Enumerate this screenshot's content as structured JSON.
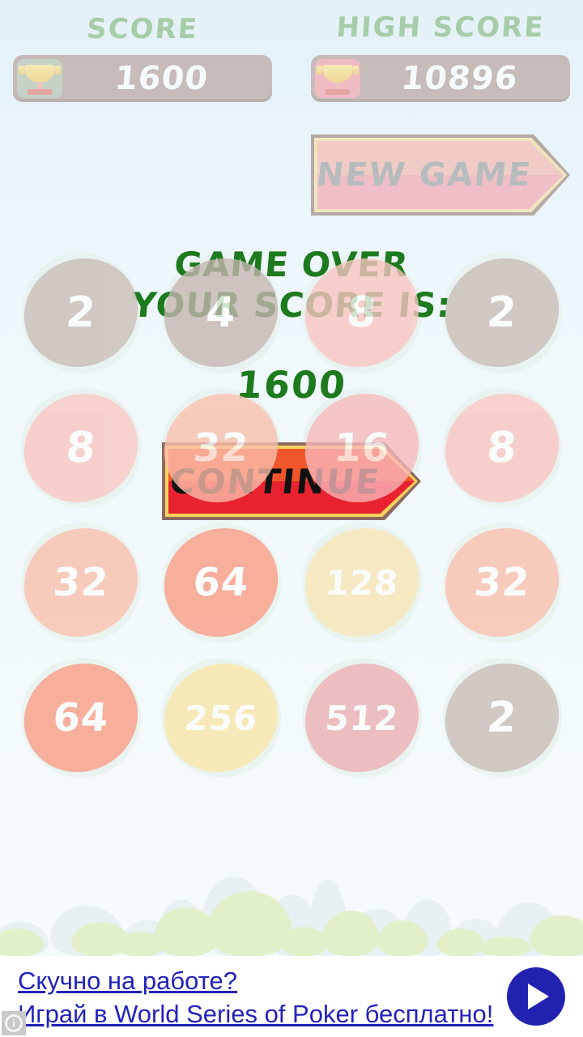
{
  "header": {
    "score_label": "Score",
    "score_value": "1600",
    "high_score_label": "High Score",
    "high_score_value": "10896",
    "score_trophy_icon": "trophy-icon",
    "high_score_trophy_icon": "trophy-icon",
    "label_color": "#8fbf8a",
    "panel_color": "#b49b92"
  },
  "new_game_button": {
    "label": "New Game",
    "label_color": "#8d8d8d",
    "fill_top": "#f6a99b",
    "fill_bottom": "#f2919c"
  },
  "game_over": {
    "line1": "Game Over",
    "line2": "Your Score is:",
    "score": "1600",
    "text_color": "#1d7a1d",
    "continue_label": "Continue",
    "continue_label_color": "#111111",
    "continue_fill_top": "#f1562a",
    "continue_fill_bottom": "#e8232f"
  },
  "grid": {
    "rows": 4,
    "cols": 4,
    "cell_bg": "#e5f1ee",
    "tiles": [
      [
        "2",
        "4",
        "8",
        "2"
      ],
      [
        "8",
        "32",
        "16",
        "8"
      ],
      [
        "32",
        "64",
        "128",
        "32"
      ],
      [
        "64",
        "256",
        "512",
        "2"
      ]
    ],
    "tile_colors": {
      "2": "#c9bcb7",
      "4": "#c6b6b1",
      "8": "#fbc6c3",
      "16": "#f9b8bc",
      "32": "#fcc0ae",
      "64": "#fb9c85",
      "128": "#f9e5b6",
      "256": "#fbe6a8",
      "512": "#eeafb4"
    }
  },
  "ad": {
    "line1": "Скучно на работе?",
    "line2": "Играй в World Series of Poker бесплатно!",
    "link_color": "#2222bb",
    "play_icon": "play-icon",
    "info_icon": "info-icon",
    "info_glyph": "i",
    "play_button_color": "#2222b0"
  }
}
